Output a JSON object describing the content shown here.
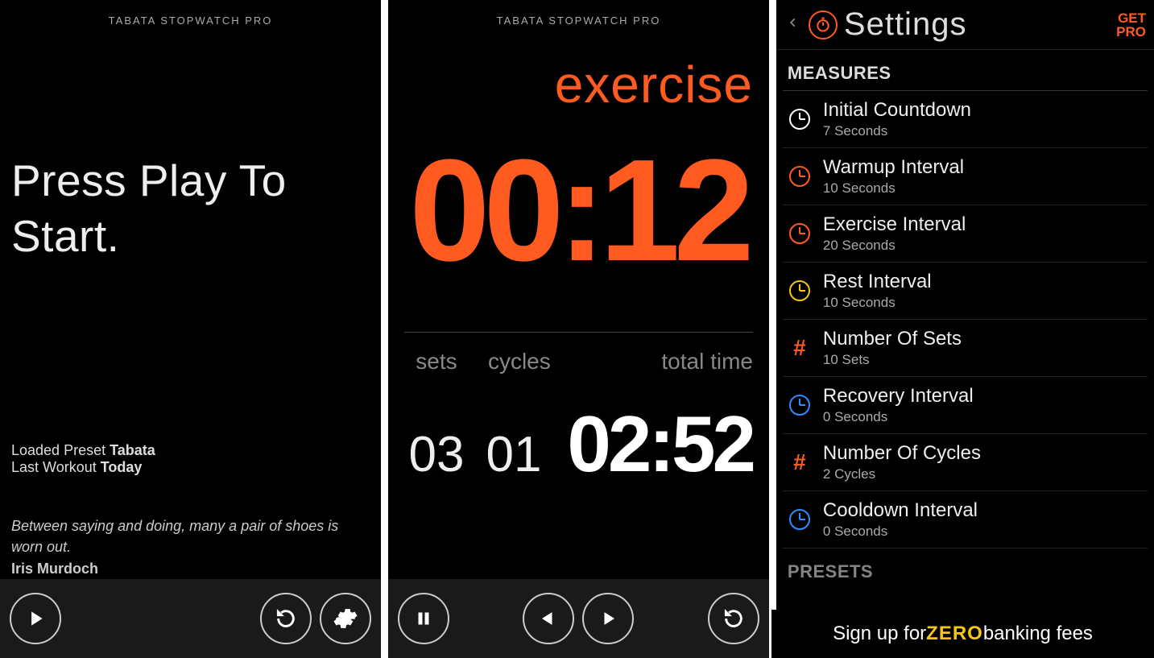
{
  "colors": {
    "accent": "#ff5a1f",
    "yellow": "#f5c518",
    "blue": "#2f8cff"
  },
  "screen1": {
    "title": "TABATA STOPWATCH PRO",
    "prompt": "Press Play To Start.",
    "loaded_label": "Loaded Preset ",
    "loaded_value": "Tabata",
    "last_label": "Last Workout ",
    "last_value": "Today",
    "quote": "Between saying and doing, many a pair of shoes is worn out.",
    "author": "Iris Murdoch"
  },
  "screen2": {
    "title": "TABATA STOPWATCH PRO",
    "phase": "exercise",
    "timer": "00:12",
    "label_sets": "sets",
    "label_cycles": "cycles",
    "label_total": "total time",
    "sets": "03",
    "cycles": "01",
    "total": "02:52"
  },
  "screen3": {
    "title": "Settings",
    "getpro_l1": "GET",
    "getpro_l2": "PRO",
    "section_measures": "MEASURES",
    "section_presets": "PRESETS",
    "items": [
      {
        "icon": "clock",
        "color": "#ffffff",
        "title": "Initial Countdown",
        "subtitle": "7 Seconds"
      },
      {
        "icon": "clock",
        "color": "#ff5a1f",
        "title": "Warmup Interval",
        "subtitle": "10 Seconds"
      },
      {
        "icon": "clock",
        "color": "#ff5a1f",
        "title": "Exercise Interval",
        "subtitle": "20 Seconds"
      },
      {
        "icon": "clock",
        "color": "#f5c518",
        "title": "Rest Interval",
        "subtitle": "10 Seconds"
      },
      {
        "icon": "hash",
        "color": "#ff5a1f",
        "title": "Number Of Sets",
        "subtitle": "10 Sets"
      },
      {
        "icon": "clock",
        "color": "#2f8cff",
        "title": "Recovery Interval",
        "subtitle": "0 Seconds"
      },
      {
        "icon": "hash",
        "color": "#ff5a1f",
        "title": "Number Of Cycles",
        "subtitle": "2 Cycles"
      },
      {
        "icon": "clock",
        "color": "#2f8cff",
        "title": "Cooldown Interval",
        "subtitle": "0 Seconds"
      }
    ]
  },
  "ad": {
    "pre": "Sign up for ",
    "highlight": "ZERO",
    "post": " banking fees"
  }
}
